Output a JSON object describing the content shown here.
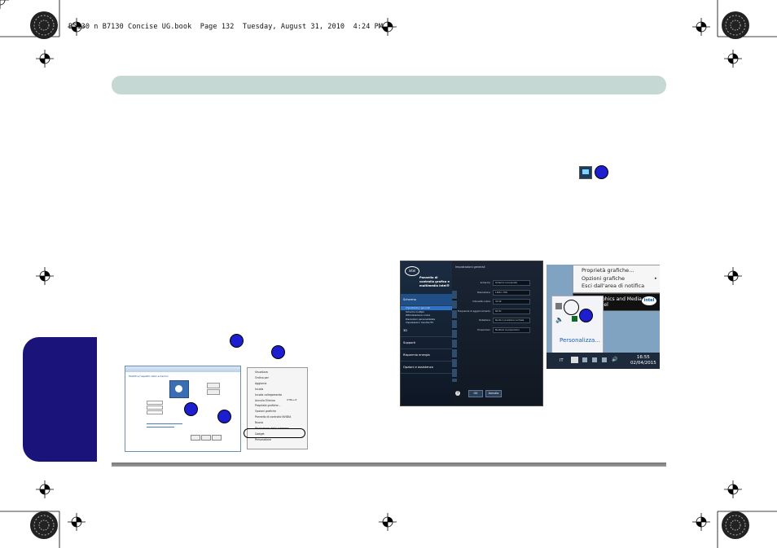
{
  "page_header": "B5130 n B7130 Concise UG.book  Page 132  Tuesday, August 31, 2010  4:24 PM",
  "screenshot_left": {
    "dialog_title": "Modifica l'aspetto dello schermo",
    "menu_items": [
      "Visualizza",
      "Ordina per",
      "Aggiorna",
      "Incolla",
      "Incolla collegamento",
      "Annulla Elimina",
      "Proprietà grafiche...",
      "Opzioni grafiche",
      "Pannello di controllo NVIDIA",
      "Nuovo",
      "Risoluzione dello schermo",
      "Gadget",
      "Personalizza"
    ],
    "menu_shortcut": "CTRL+Z"
  },
  "screenshot_middle": {
    "panel_title": "Pannello di controllo grafica e multimedia Intel®",
    "nav_items": [
      "Schermo",
      "Impostazioni generali",
      "Schermi multipli",
      "Ottimizzazione colore",
      "Risoluzioni personalizzate",
      "Impostazioni monitor/TV",
      "3D",
      "Supporti",
      "Risparmio energia",
      "Opzioni e assistenza"
    ],
    "section_title": "Impostazioni generali",
    "fields": [
      {
        "label": "Schermo",
        "value": "Schermo incorporato"
      },
      {
        "label": "Risoluzione",
        "value": "1366 x 768"
      },
      {
        "label": "Intensità colore",
        "value": "32 bit"
      },
      {
        "label": "Frequenza di aggiornamento",
        "value": "60 Hz"
      },
      {
        "label": "Rotazione",
        "value": "Ruota in posizione normale"
      },
      {
        "label": "Proporzioni",
        "value": "Mantieni le proporzioni"
      }
    ],
    "ok_label": "OK",
    "cancel_label": "Annulla",
    "brand": "intel"
  },
  "screenshot_right": {
    "menu_items": [
      "Proprietà grafiche...",
      "Opzioni grafiche",
      "Esci dall'area di notifica"
    ],
    "tooltip_line1": "Intel® Graphics and Media",
    "tooltip_line2": "Control Panel",
    "brand": "intel",
    "customize_link": "Personalizza...",
    "taskbar_lang": "IT",
    "clock_time": "16:55",
    "clock_date": "02/04/2015"
  }
}
